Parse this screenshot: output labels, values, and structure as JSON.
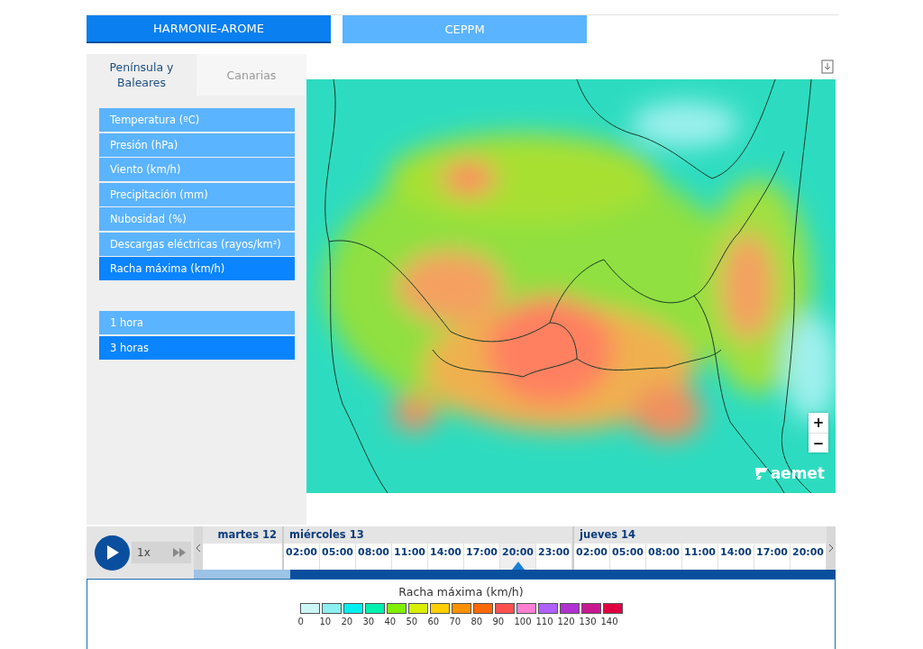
{
  "model_tabs": [
    {
      "label": "HARMONIE-AROME",
      "selected": true
    },
    {
      "label": "CEPPM",
      "selected": false
    }
  ],
  "region_tabs": [
    {
      "label": "Península y Baleares",
      "selected": true
    },
    {
      "label": "Canarias",
      "selected": false
    }
  ],
  "variables": [
    {
      "label": "Temperatura (ºC)",
      "selected": false
    },
    {
      "label": "Presión (hPa)",
      "selected": false
    },
    {
      "label": "Viento (km/h)",
      "selected": false
    },
    {
      "label": "Precipitación (mm)",
      "selected": false
    },
    {
      "label": "Nubosidad (%)",
      "selected": false
    },
    {
      "label": "Descargas eléctricas (rayos/km²)",
      "selected": false
    },
    {
      "label": "Racha máxima (km/h)",
      "selected": true
    }
  ],
  "intervals": [
    {
      "label": "1 hora",
      "selected": false
    },
    {
      "label": "3 horas",
      "selected": true
    }
  ],
  "map": {
    "logo": "aemet",
    "zoom_in": "+",
    "zoom_out": "−"
  },
  "player": {
    "speed": "1x"
  },
  "timeline_bar": {
    "level": 0.85
  },
  "timeline": [
    {
      "day": "martes 12"
    },
    {
      "day": "miércoles 13",
      "slots": [
        {
          "time": "02:00",
          "selected": false
        },
        {
          "time": "05:00",
          "selected": false
        },
        {
          "time": "08:00",
          "selected": false
        },
        {
          "time": "11:00",
          "selected": false
        },
        {
          "time": "14:00",
          "selected": false
        },
        {
          "time": "17:00",
          "selected": false
        },
        {
          "time": "20:00",
          "selected": true
        },
        {
          "time": "23:00",
          "selected": false
        }
      ]
    },
    {
      "day": "jueves 14",
      "slots": [
        {
          "time": "02:00",
          "selected": false
        },
        {
          "time": "05:00",
          "selected": false
        },
        {
          "time": "08:00",
          "selected": false
        },
        {
          "time": "11:00",
          "selected": false
        },
        {
          "time": "14:00",
          "selected": false
        },
        {
          "time": "17:00",
          "selected": false
        },
        {
          "time": "20:00",
          "selected": false
        }
      ]
    }
  ],
  "legend": {
    "title": "Racha máxima (km/h)",
    "steps": [
      {
        "label": "0",
        "color": "#ccf7f7"
      },
      {
        "label": "10",
        "color": "#8cf0f0"
      },
      {
        "label": "20",
        "color": "#00f0f0"
      },
      {
        "label": "30",
        "color": "#00f0b0"
      },
      {
        "label": "40",
        "color": "#80f000"
      },
      {
        "label": "50",
        "color": "#d8f000"
      },
      {
        "label": "60",
        "color": "#ffd000"
      },
      {
        "label": "70",
        "color": "#ff9000"
      },
      {
        "label": "80",
        "color": "#ff6a00"
      },
      {
        "label": "90",
        "color": "#ff5050"
      },
      {
        "label": "100",
        "color": "#ff80d0"
      },
      {
        "label": "110",
        "color": "#b060ff"
      },
      {
        "label": "120",
        "color": "#b030d0"
      },
      {
        "label": "130",
        "color": "#c81890"
      },
      {
        "label": "140",
        "color": "#e00040"
      }
    ]
  }
}
